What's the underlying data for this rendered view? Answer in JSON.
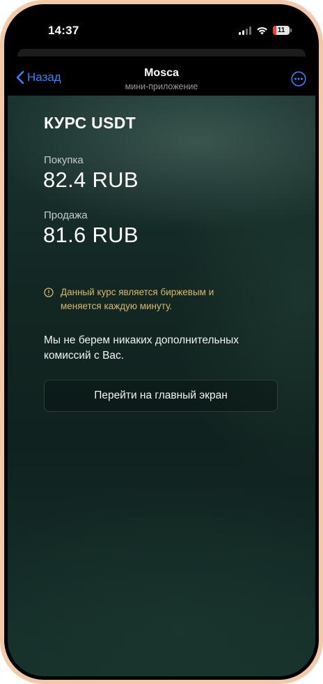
{
  "status_bar": {
    "time": "14:37",
    "battery_level": "11",
    "icons": [
      "cellular-signal-icon",
      "wifi-icon",
      "battery-icon"
    ]
  },
  "navbar": {
    "back_label": "Назад",
    "title": "Mosca",
    "subtitle": "мини-приложение",
    "more_icon": "ellipsis-circle-icon"
  },
  "rate": {
    "heading": "КУРС USDT",
    "buy_label": "Покупка",
    "buy_value": "82.4 RUB",
    "sell_label": "Продажа",
    "sell_value": "81.6 RUB"
  },
  "warning": {
    "icon": "info-circle-icon",
    "text": "Данный курс является биржевым и меняется каждую минуту."
  },
  "note": "Мы не берем никаких дополнительных комиссий с Вас.",
  "main_button_label": "Перейти на главный экран",
  "colors": {
    "accent_blue": "#3a82f7",
    "warning_gold": "#d9b96a",
    "frame": "#f4c9a8",
    "background_green": "#122622"
  }
}
